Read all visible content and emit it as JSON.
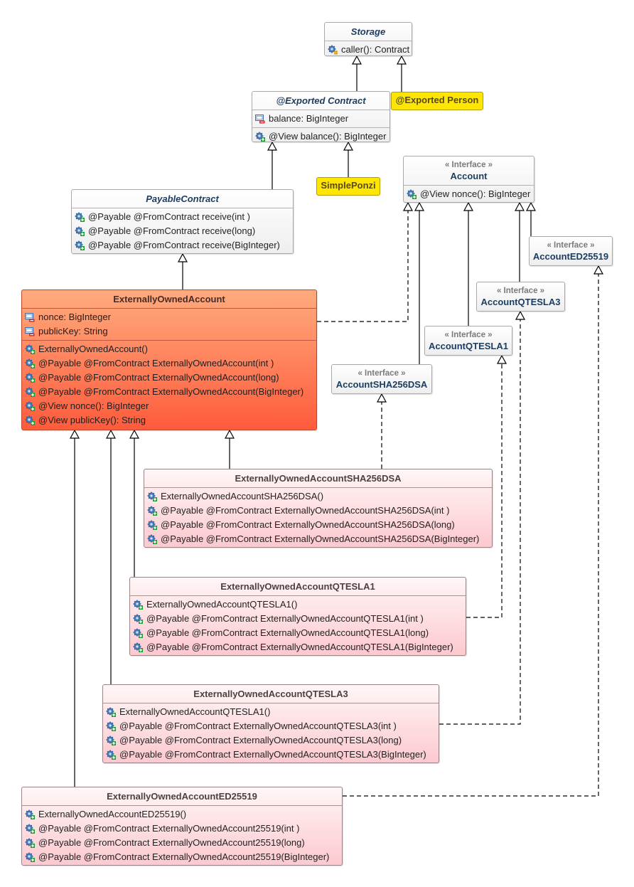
{
  "diagram_title": "UML class diagram",
  "colors": {
    "header_text": "#1b3c5e",
    "note_fill": "#ffe600",
    "eoa_top": "#ffab7d",
    "eoa_bottom": "#ff5b3c",
    "sub_top": "#fff6f6",
    "sub_bottom": "#fcc9cf"
  },
  "icons": {
    "method_public": "gear-plus-icon",
    "method_protected": "gear-hash-icon",
    "field_private": "field-minus-icon"
  },
  "classes": {
    "storage": {
      "name": "Storage",
      "methods": [
        "caller(): Contract"
      ]
    },
    "contract": {
      "name": "@Exported Contract",
      "fields": [
        "balance: BigInteger"
      ],
      "methods": [
        "@View balance(): BigInteger"
      ]
    },
    "person": {
      "name": "@Exported Person"
    },
    "simple_ponzi": {
      "name": "SimplePonzi"
    },
    "payable_contract": {
      "name": "PayableContract",
      "methods": [
        "@Payable @FromContract receive(int )",
        "@Payable @FromContract receive(long)",
        "@Payable @FromContract receive(BigInteger)"
      ]
    },
    "account": {
      "stereotype": "« Interface »",
      "name": "Account",
      "methods": [
        "@View nonce(): BigInteger"
      ]
    },
    "account_ed25519": {
      "stereotype": "« Interface »",
      "name": "AccountED25519"
    },
    "account_qtesla3": {
      "stereotype": "« Interface »",
      "name": "AccountQTESLA3"
    },
    "account_qtesla1": {
      "stereotype": "« Interface »",
      "name": "AccountQTESLA1"
    },
    "account_sha256dsa": {
      "stereotype": "« Interface »",
      "name": "AccountSHA256DSA"
    },
    "eoa": {
      "name": "ExternallyOwnedAccount",
      "fields": [
        "nonce: BigInteger",
        "publicKey: String"
      ],
      "methods": [
        "ExternallyOwnedAccount()",
        "@Payable @FromContract ExternallyOwnedAccount(int )",
        "@Payable @FromContract ExternallyOwnedAccount(long)",
        "@Payable @FromContract ExternallyOwnedAccount(BigInteger)",
        "@View nonce(): BigInteger",
        "@View publicKey(): String"
      ]
    },
    "eoa_sha256dsa": {
      "name": "ExternallyOwnedAccountSHA256DSA",
      "methods": [
        "ExternallyOwnedAccountSHA256DSA()",
        "@Payable @FromContract ExternallyOwnedAccountSHA256DSA(int )",
        "@Payable @FromContract ExternallyOwnedAccountSHA256DSA(long)",
        "@Payable @FromContract ExternallyOwnedAccountSHA256DSA(BigInteger)"
      ]
    },
    "eoa_qtesla1": {
      "name": "ExternallyOwnedAccountQTESLA1",
      "methods": [
        "ExternallyOwnedAccountQTESLA1()",
        "@Payable @FromContract ExternallyOwnedAccountQTESLA1(int )",
        "@Payable @FromContract ExternallyOwnedAccountQTESLA1(long)",
        "@Payable @FromContract ExternallyOwnedAccountQTESLA1(BigInteger)"
      ]
    },
    "eoa_qtesla3": {
      "name": "ExternallyOwnedAccountQTESLA3",
      "methods": [
        "ExternallyOwnedAccountQTESLA1()",
        "@Payable @FromContract ExternallyOwnedAccountQTESLA3(int )",
        "@Payable @FromContract ExternallyOwnedAccountQTESLA3(long)",
        "@Payable @FromContract ExternallyOwnedAccountQTESLA3(BigInteger)"
      ]
    },
    "eoa_ed25519": {
      "name": "ExternallyOwnedAccountED25519",
      "methods": [
        "ExternallyOwnedAccountED25519()",
        "@Payable @FromContract ExternallyOwnedAccount25519(int )",
        "@Payable @FromContract ExternallyOwnedAccount25519(long)",
        "@Payable @FromContract ExternallyOwnedAccount25519(BigInteger)"
      ]
    }
  },
  "relations": [
    {
      "from": "contract",
      "to": "storage",
      "type": "generalization"
    },
    {
      "from": "person",
      "to": "storage",
      "type": "generalization"
    },
    {
      "from": "payable_contract",
      "to": "contract",
      "type": "generalization"
    },
    {
      "from": "simple_ponzi",
      "to": "contract",
      "type": "generalization"
    },
    {
      "from": "eoa",
      "to": "payable_contract",
      "type": "generalization"
    },
    {
      "from": "eoa",
      "to": "account",
      "type": "realization"
    },
    {
      "from": "account_sha256dsa",
      "to": "account",
      "type": "generalization"
    },
    {
      "from": "account_qtesla1",
      "to": "account",
      "type": "generalization"
    },
    {
      "from": "account_qtesla3",
      "to": "account",
      "type": "generalization"
    },
    {
      "from": "account_ed25519",
      "to": "account",
      "type": "generalization"
    },
    {
      "from": "eoa_sha256dsa",
      "to": "eoa",
      "type": "generalization"
    },
    {
      "from": "eoa_sha256dsa",
      "to": "account_sha256dsa",
      "type": "realization"
    },
    {
      "from": "eoa_qtesla1",
      "to": "eoa",
      "type": "generalization"
    },
    {
      "from": "eoa_qtesla1",
      "to": "account_qtesla1",
      "type": "realization"
    },
    {
      "from": "eoa_qtesla3",
      "to": "eoa",
      "type": "generalization"
    },
    {
      "from": "eoa_qtesla3",
      "to": "account_qtesla3",
      "type": "realization"
    },
    {
      "from": "eoa_ed25519",
      "to": "eoa",
      "type": "generalization"
    },
    {
      "from": "eoa_ed25519",
      "to": "account_ed25519",
      "type": "realization"
    }
  ]
}
